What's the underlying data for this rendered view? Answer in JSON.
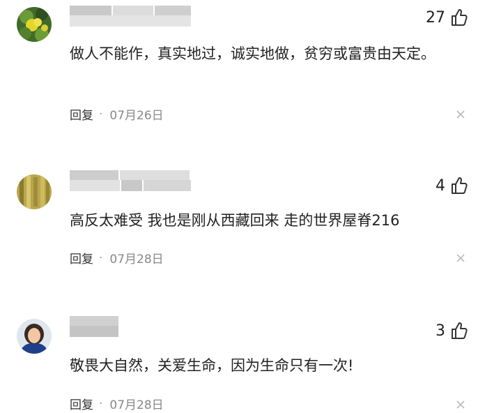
{
  "comments": [
    {
      "likes": "27",
      "text": "做人不能作，真实地过，诚实地做，贫穷或富贵由天定。",
      "reply_label": "回复",
      "separator": "·",
      "date": "07月26日"
    },
    {
      "likes": "4",
      "text": "高反太难受 我也是刚从西藏回来 走的世界屋脊216",
      "reply_label": "回复",
      "separator": "·",
      "date": "07月28日"
    },
    {
      "likes": "3",
      "text": "敬畏大自然，关爱生命，因为生命只有一次!",
      "reply_label": "回复",
      "separator": "·",
      "date": "07月28日"
    }
  ],
  "icons": {
    "like": "thumbs-up-icon",
    "dismiss": "close-icon"
  }
}
